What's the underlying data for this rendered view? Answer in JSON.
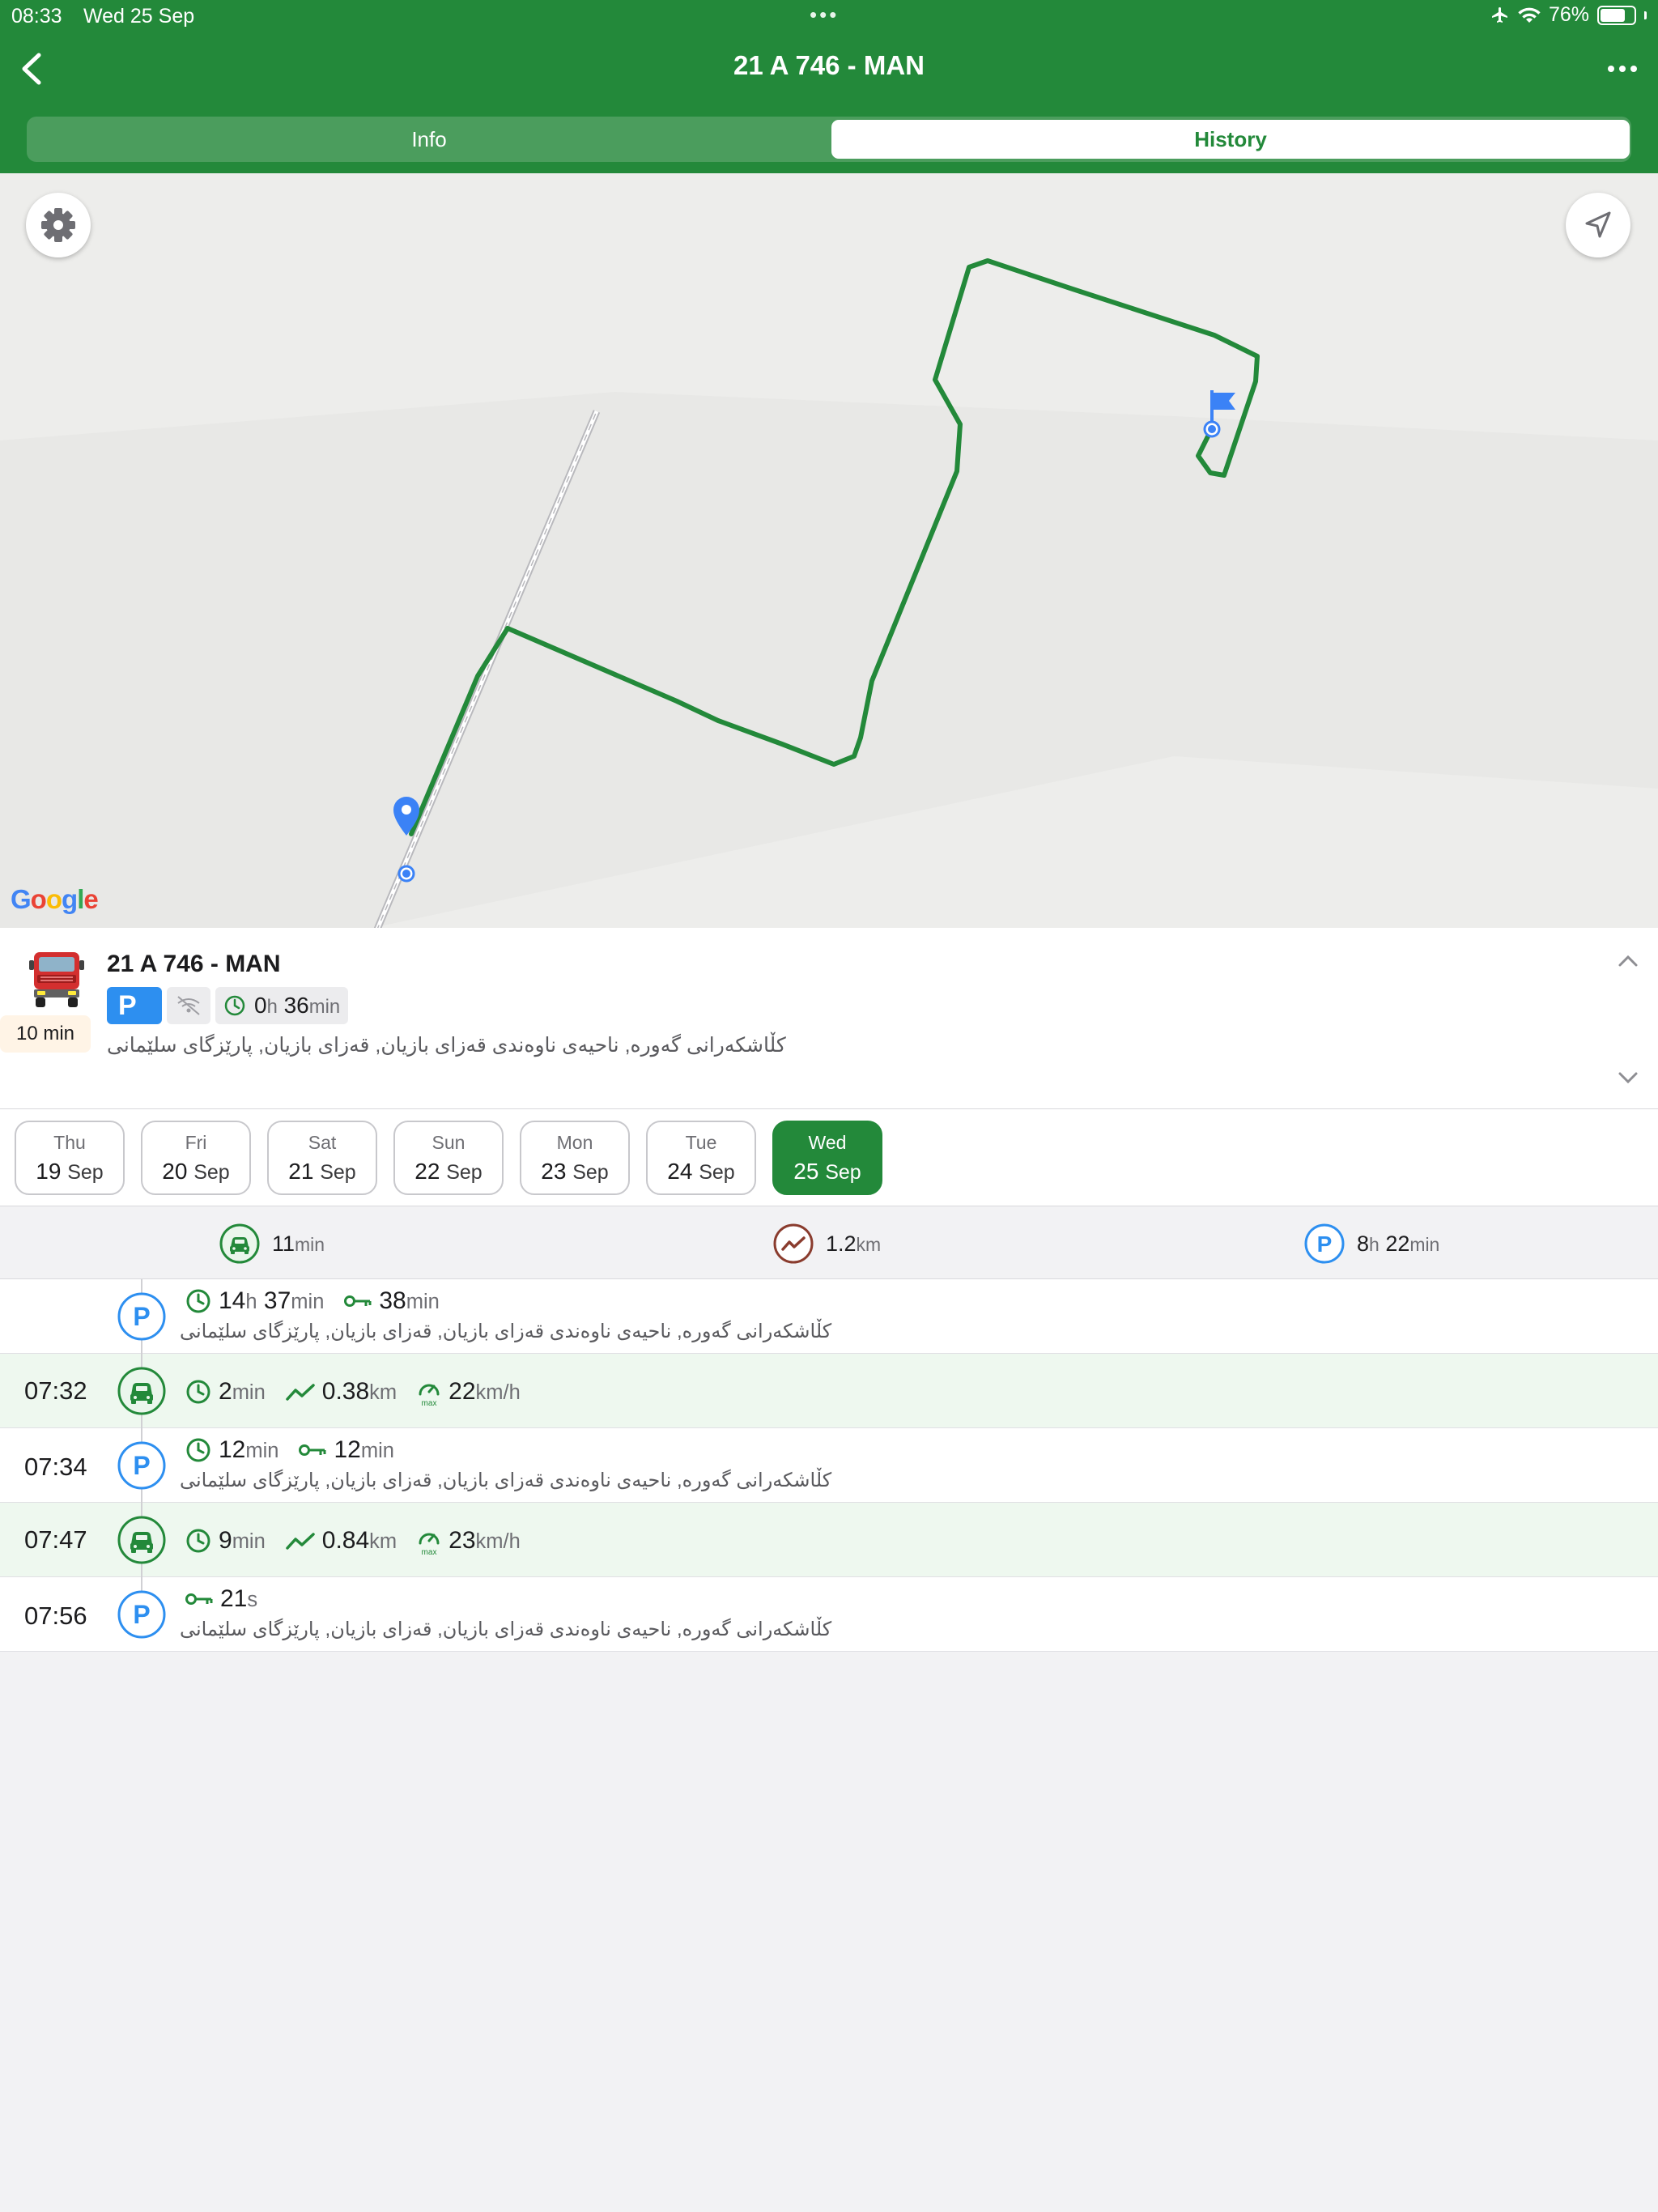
{
  "status_bar": {
    "time": "08:33",
    "date": "Wed 25 Sep",
    "battery": "76%",
    "battery_level": 0.76
  },
  "nav": {
    "title": "21 A 746 - MAN"
  },
  "tabs": [
    {
      "label": "Info"
    },
    {
      "label": "History"
    }
  ],
  "active_tab": "History",
  "map": {
    "provider": "Google"
  },
  "vehicle": {
    "name": "21 A 746 - MAN",
    "eta": "10 min",
    "status_letter": "P",
    "duration": {
      "h": "0",
      "h_unit": "h",
      "m": "36",
      "m_unit": "min"
    },
    "address": "کڵاشکەرانی گەورە, ناحیەی ناوەندی قەزای بازیان, قەزای بازیان, پارێزگای سلێمانی"
  },
  "days": [
    {
      "name": "Thu",
      "day": "19",
      "month": "Sep",
      "active": false
    },
    {
      "name": "Fri",
      "day": "20",
      "month": "Sep",
      "active": false
    },
    {
      "name": "Sat",
      "day": "21",
      "month": "Sep",
      "active": false
    },
    {
      "name": "Sun",
      "day": "22",
      "month": "Sep",
      "active": false
    },
    {
      "name": "Mon",
      "day": "23",
      "month": "Sep",
      "active": false
    },
    {
      "name": "Tue",
      "day": "24",
      "month": "Sep",
      "active": false
    },
    {
      "name": "Wed",
      "day": "25",
      "month": "Sep",
      "active": true
    }
  ],
  "summary": {
    "drive": {
      "v1": "11",
      "u1": "min"
    },
    "distance": {
      "v1": "1.2",
      "u1": "km"
    },
    "parking": {
      "v1": "8",
      "u1": "h",
      "v2": "22",
      "u2": "min"
    }
  },
  "timeline": [
    {
      "type": "park",
      "time": "",
      "dur": {
        "v1": "14",
        "u1": "h",
        "v2": "37",
        "u2": "min"
      },
      "ign": {
        "v1": "38",
        "u1": "min"
      },
      "address": "کڵاشکەرانی گەورە, ناحیەی ناوەندی قەزای بازیان, قەزای بازیان, پارێزگای سلێمانی"
    },
    {
      "type": "drive",
      "time": "07:32",
      "dur": {
        "v1": "2",
        "u1": "min"
      },
      "dist": {
        "v1": "0.38",
        "u1": "km"
      },
      "speed": {
        "v1": "22",
        "u1": "km/h"
      },
      "max_label": "max"
    },
    {
      "type": "park",
      "time": "07:34",
      "dur": {
        "v1": "12",
        "u1": "min"
      },
      "ign": {
        "v1": "12",
        "u1": "min"
      },
      "address": "کڵاشکەرانی گەورە, ناحیەی ناوەندی قەزای بازیان, قەزای بازیان, پارێزگای سلێمانی"
    },
    {
      "type": "drive",
      "time": "07:47",
      "dur": {
        "v1": "9",
        "u1": "min"
      },
      "dist": {
        "v1": "0.84",
        "u1": "km"
      },
      "speed": {
        "v1": "23",
        "u1": "km/h"
      },
      "max_label": "max"
    },
    {
      "type": "park",
      "time": "07:56",
      "ign": {
        "v1": "21",
        "u1": "s"
      },
      "address": "کڵاشکەرانی گەورە, ناحیەی ناوەندی قەزای بازیان, قەزای بازیان, پارێزگای سلێمانی"
    }
  ],
  "colors": {
    "brand_green": "#23893a",
    "parking_blue": "#2d8ff0",
    "drive_row_bg": "#eef8ef",
    "route": "#23893a"
  }
}
